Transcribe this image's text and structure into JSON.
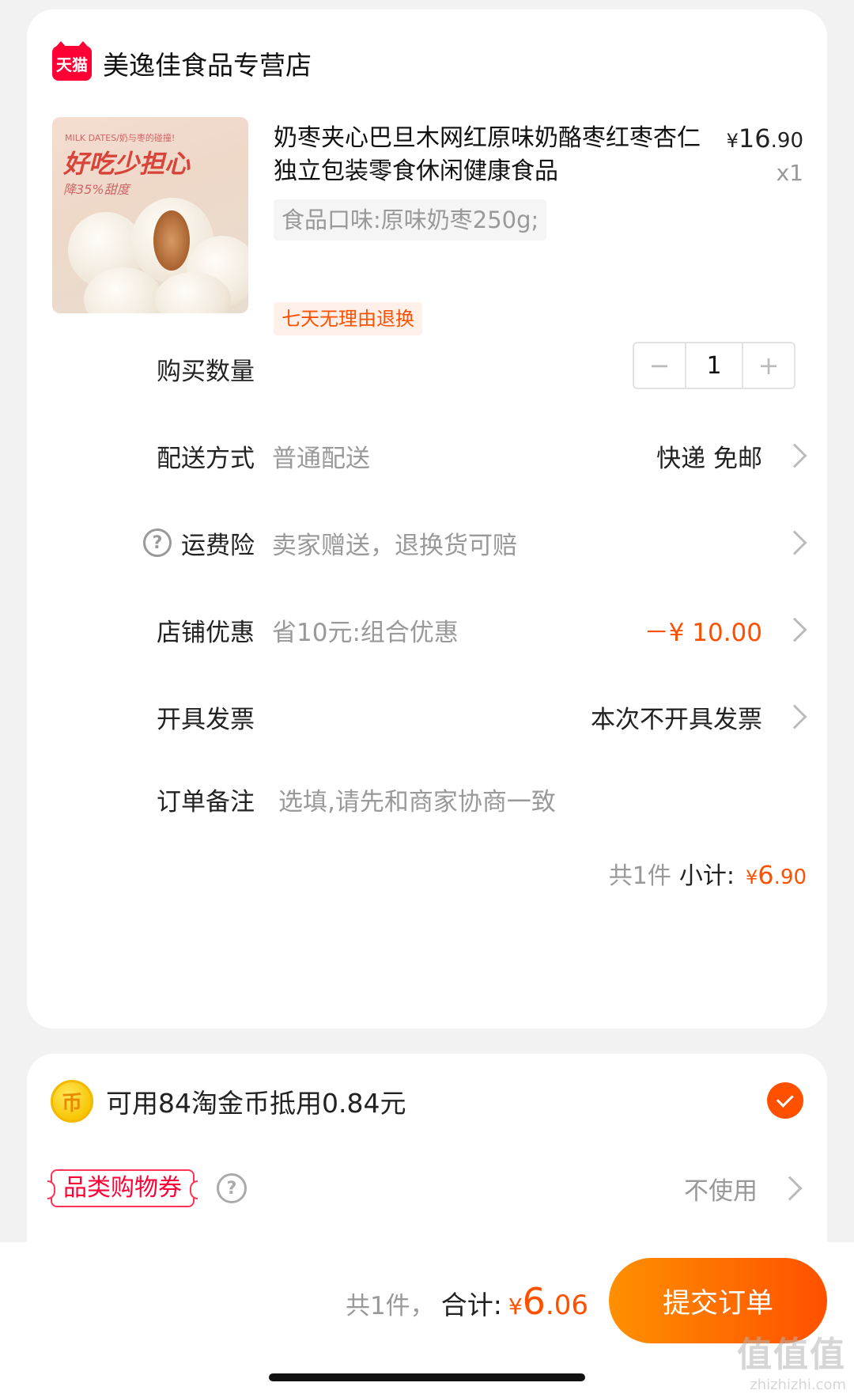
{
  "shop": {
    "logo_text": "天猫",
    "name": "美逸佳食品专营店"
  },
  "product": {
    "image_sub": "MILK DATES/奶与枣的碰撞!",
    "image_main": "好吃少担心",
    "image_note": "降35%甜度",
    "title": "奶枣夹心巴旦木网红原味奶酪枣红枣杏仁独立包装零食休闲健康食品",
    "price_yen": "¥",
    "price_int": "16",
    "price_cents": ".90",
    "quantity": "x1",
    "spec": "食品口味:原味奶枣250g;",
    "return_tag": "七天无理由退换"
  },
  "rows": {
    "quantity_label": "购买数量",
    "quantity_value": "1",
    "minus": "−",
    "plus": "+",
    "delivery_label": "配送方式",
    "delivery_sub": "普通配送",
    "delivery_value": "快递 免邮",
    "insurance_help": "?",
    "insurance_label": "运费险",
    "insurance_sub": "卖家赠送，退换货可赔",
    "discount_label": "店铺优惠",
    "discount_sub": "省10元:组合优惠",
    "discount_value": "－¥ 10.00",
    "invoice_label": "开具发票",
    "invoice_value": "本次不开具发票",
    "note_label": "订单备注",
    "note_placeholder": "选填,请先和商家协商一致"
  },
  "subtotal": {
    "count": "共1件",
    "label": "小计:",
    "yen": "¥",
    "int": "6",
    "cents": ".90"
  },
  "coins": {
    "icon_glyph": "币",
    "text": "可用84淘金币抵用0.84元",
    "checked": true
  },
  "coupon": {
    "tag": "品类购物券",
    "help": "?",
    "value": "不使用"
  },
  "bottom": {
    "count": "共1件，",
    "label": "合计:",
    "yen": "¥",
    "int": "6",
    "cents": ".06",
    "submit": "提交订单",
    "watermark_main": "值值值",
    "watermark_sub": "zhizhizhi.com"
  },
  "colors": {
    "accent": "#ff5000",
    "tmall_red": "#ff0036",
    "background": "#f2f2f2"
  }
}
